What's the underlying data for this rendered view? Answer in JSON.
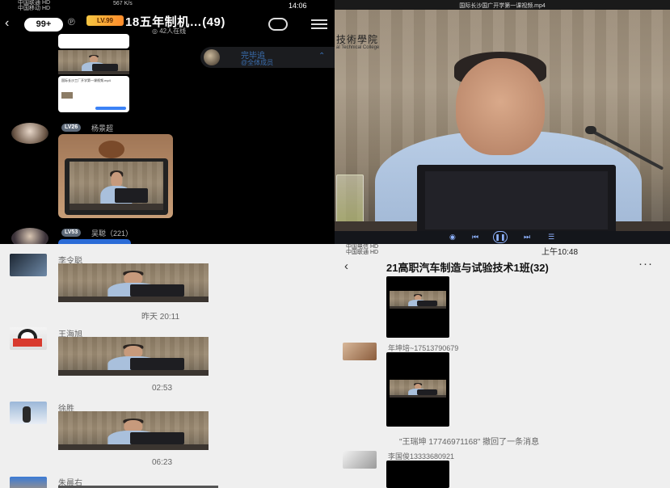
{
  "q1": {
    "status_carriers": [
      "中国联通 HD",
      "中国移动 HD"
    ],
    "status_speed": "567 K/s",
    "status_time": "14:06",
    "unread_count": "99+",
    "level_badge": "LV.99",
    "group_title": "18五年制机…",
    "member_count": "(49)",
    "online_count": "42人在线",
    "shared_banner_line1": "完毕追",
    "shared_banner_line2": "@全体成员",
    "members": [
      {
        "level": "LV26",
        "name": "杨景超"
      },
      {
        "level": "LV53",
        "name": "吴聪（221）"
      }
    ],
    "doc_card_caption": "国际长沙工厂开学第一课视频.mp4"
  },
  "q2": {
    "file_title": "国际长沙国广开学第一课视频.mp4",
    "banner_text": "技術學院",
    "banner_sub": "al Technical College"
  },
  "q3": {
    "messages": [
      {
        "name": "李令聪",
        "time": "昨天 20:11"
      },
      {
        "name": "王海旭",
        "time": "02:53"
      },
      {
        "name": "徐胜",
        "time": "06:23"
      },
      {
        "name": "朱晨右",
        "time": ""
      }
    ]
  },
  "q4": {
    "status_carriers": [
      "中国电信 HD",
      "中国联通 HD"
    ],
    "status_right": "上午10:48",
    "chat_title": "21高职汽车制造与试验技术1班(32)",
    "senders": [
      "年坤培~17513790679",
      "李国俊13333680921"
    ],
    "system_note": "\"王瑞坤 17746971168\" 撤回了一条消息"
  }
}
